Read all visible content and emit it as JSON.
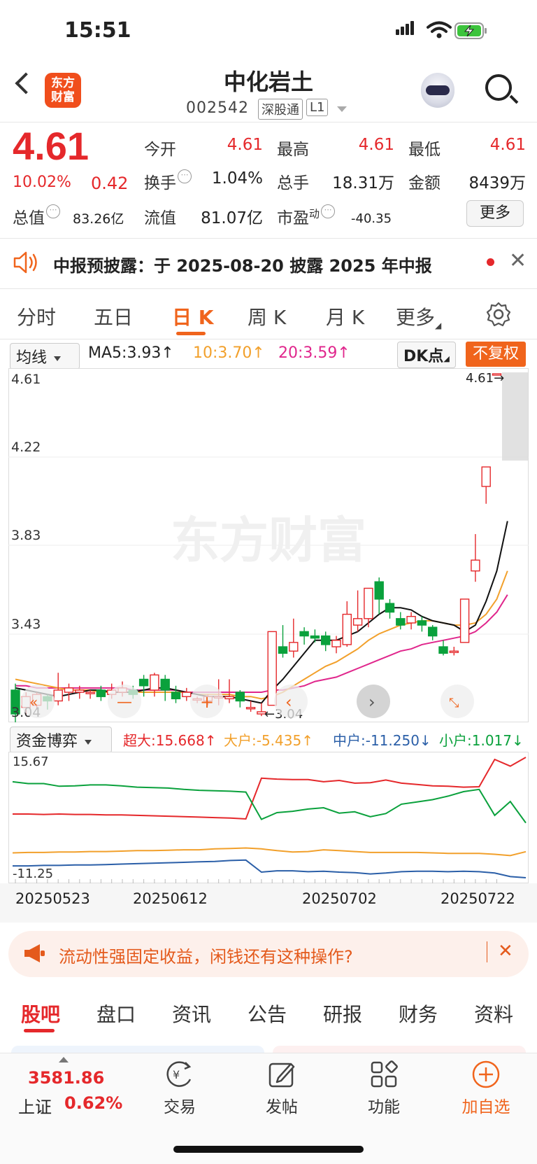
{
  "status_bar": {
    "time": "15:51"
  },
  "header": {
    "logo": "东方财富",
    "title": "中化岩土",
    "code": "002542",
    "tags": [
      "深股通",
      "L1"
    ]
  },
  "quote": {
    "price": "4.61",
    "change_pct": "10.02%",
    "change": "0.42",
    "fields": [
      {
        "label": "今开",
        "value": "4.61"
      },
      {
        "label": "最高",
        "value": "4.61"
      },
      {
        "label": "最低",
        "value": "4.61"
      },
      {
        "label": "换手",
        "value": "1.04%"
      },
      {
        "label": "总手",
        "value": "18.31万"
      },
      {
        "label": "金额",
        "value": "8439万"
      },
      {
        "label": "总值",
        "value": "83.26亿"
      },
      {
        "label": "流值",
        "value": "81.07亿"
      },
      {
        "label": "市盈",
        "sup": "动",
        "value": "-40.35"
      }
    ],
    "more_label": "更多"
  },
  "notice": {
    "text": "中报预披露：于 2025-08-20 披露 2025 年中报"
  },
  "chart_tabs": [
    "分时",
    "五日",
    "日 K",
    "周 K",
    "月 K",
    "更多"
  ],
  "chart_toolbar": {
    "indicator": "均线",
    "ma5": "MA5:3.93↑",
    "ma10": "10:3.70↑",
    "ma20": "20:3.59↑",
    "dk": "DK点",
    "fuquan": "不复权"
  },
  "kline": {
    "y_labels": [
      "4.61",
      "4.22",
      "3.83",
      "3.43",
      "3.04"
    ],
    "max_marker": "4.61→",
    "min_marker": "←3.04",
    "watermark": "东方财富"
  },
  "capital_toolbar": {
    "indicator": "资金博弈",
    "super": "超大:15.668↑",
    "large": "大户:-5.435↑",
    "mid": "中户:-11.250↓",
    "small": "小户:1.017↓"
  },
  "capital": {
    "y_top": "15.67",
    "y_bottom": "-11.25"
  },
  "x_dates": [
    "20250523",
    "20250612",
    "20250702",
    "20250722"
  ],
  "colors": {
    "up": "#e5282b",
    "down": "#0aa13c",
    "ma5": "#111111",
    "ma10": "#f2a02b",
    "ma20": "#e0268c",
    "mid": "#2b5fa8",
    "accent": "#f0641c"
  },
  "chart_data": {
    "type": "candlestick",
    "ylim": [
      3.04,
      4.61
    ],
    "candles": [
      [
        3.15,
        3.04,
        3.18,
        3.0
      ],
      [
        3.07,
        3.12,
        3.14,
        3.04
      ],
      [
        3.08,
        3.13,
        3.14,
        3.06
      ],
      [
        3.12,
        3.1,
        3.13,
        3.06
      ],
      [
        3.1,
        3.15,
        3.23,
        3.08
      ],
      [
        3.14,
        3.16,
        3.18,
        3.1
      ],
      [
        3.14,
        3.15,
        3.17,
        3.11
      ],
      [
        3.14,
        3.14,
        3.15,
        3.11
      ],
      [
        3.15,
        3.12,
        3.17,
        3.1
      ],
      [
        3.13,
        3.15,
        3.18,
        3.11
      ],
      [
        3.14,
        3.16,
        3.19,
        3.12
      ],
      [
        3.15,
        3.13,
        3.17,
        3.11
      ],
      [
        3.2,
        3.17,
        3.22,
        3.12
      ],
      [
        3.15,
        3.22,
        3.23,
        3.12
      ],
      [
        3.2,
        3.15,
        3.22,
        3.1
      ],
      [
        3.14,
        3.11,
        3.17,
        3.09
      ],
      [
        3.12,
        3.14,
        3.16,
        3.1
      ],
      [
        3.11,
        3.11,
        3.12,
        3.09
      ],
      [
        3.1,
        3.12,
        3.13,
        3.08
      ],
      [
        3.12,
        3.12,
        3.2,
        3.08
      ],
      [
        3.11,
        3.12,
        3.2,
        3.09
      ],
      [
        3.14,
        3.1,
        3.15,
        3.07
      ],
      [
        3.07,
        3.07,
        3.1,
        3.05
      ],
      [
        3.04,
        3.05,
        3.09,
        3.03
      ],
      [
        3.08,
        3.42,
        3.42,
        3.08
      ],
      [
        3.35,
        3.32,
        3.45,
        3.3
      ],
      [
        3.33,
        3.37,
        3.48,
        3.3
      ],
      [
        3.42,
        3.4,
        3.44,
        3.36
      ],
      [
        3.4,
        3.39,
        3.43,
        3.37
      ],
      [
        3.4,
        3.36,
        3.42,
        3.33
      ],
      [
        3.35,
        3.38,
        3.4,
        3.32
      ],
      [
        3.36,
        3.5,
        3.56,
        3.35
      ],
      [
        3.45,
        3.48,
        3.61,
        3.42
      ],
      [
        3.48,
        3.62,
        3.62,
        3.44
      ],
      [
        3.65,
        3.57,
        3.67,
        3.5
      ],
      [
        3.55,
        3.51,
        3.57,
        3.48
      ],
      [
        3.48,
        3.45,
        3.51,
        3.43
      ],
      [
        3.46,
        3.49,
        3.51,
        3.43
      ],
      [
        3.47,
        3.45,
        3.49,
        3.42
      ],
      [
        3.44,
        3.4,
        3.45,
        3.38
      ],
      [
        3.35,
        3.32,
        3.38,
        3.31
      ],
      [
        3.33,
        3.33,
        3.35,
        3.31
      ],
      [
        3.37,
        3.57,
        3.57,
        3.37
      ],
      [
        3.7,
        3.75,
        3.87,
        3.65
      ],
      [
        4.09,
        4.18,
        4.18,
        4.01
      ],
      [
        4.61,
        4.61,
        4.61,
        4.61
      ]
    ],
    "ma5": [
      3.16,
      3.15,
      3.14,
      3.13,
      3.12,
      3.13,
      3.14,
      3.15,
      3.15,
      3.14,
      3.14,
      3.14,
      3.15,
      3.16,
      3.16,
      3.15,
      3.14,
      3.13,
      3.12,
      3.12,
      3.12,
      3.11,
      3.1,
      3.09,
      3.15,
      3.2,
      3.26,
      3.32,
      3.38,
      3.38,
      3.38,
      3.4,
      3.42,
      3.46,
      3.5,
      3.53,
      3.53,
      3.52,
      3.49,
      3.47,
      3.46,
      3.45,
      3.42,
      3.45,
      3.56,
      3.7,
      3.93
    ],
    "ma10": [
      3.2,
      3.19,
      3.18,
      3.17,
      3.16,
      3.15,
      3.15,
      3.15,
      3.14,
      3.14,
      3.14,
      3.14,
      3.14,
      3.14,
      3.14,
      3.14,
      3.14,
      3.13,
      3.13,
      3.13,
      3.13,
      3.12,
      3.12,
      3.11,
      3.12,
      3.14,
      3.17,
      3.2,
      3.23,
      3.26,
      3.28,
      3.31,
      3.34,
      3.38,
      3.41,
      3.43,
      3.45,
      3.46,
      3.47,
      3.47,
      3.46,
      3.45,
      3.45,
      3.46,
      3.5,
      3.57,
      3.7
    ],
    "ma20": [
      3.17,
      3.17,
      3.16,
      3.16,
      3.16,
      3.16,
      3.16,
      3.16,
      3.16,
      3.16,
      3.16,
      3.15,
      3.15,
      3.15,
      3.15,
      3.15,
      3.14,
      3.14,
      3.14,
      3.14,
      3.14,
      3.14,
      3.14,
      3.14,
      3.15,
      3.15,
      3.16,
      3.17,
      3.19,
      3.2,
      3.21,
      3.23,
      3.25,
      3.27,
      3.29,
      3.31,
      3.33,
      3.34,
      3.36,
      3.37,
      3.38,
      3.39,
      3.4,
      3.42,
      3.46,
      3.51,
      3.59
    ],
    "capital_series": [
      {
        "name": "超大",
        "values": [
          3.0,
          3.0,
          2.9,
          3.0,
          2.9,
          2.9,
          2.8,
          2.8,
          2.7,
          2.6,
          2.5,
          2.4,
          2.3,
          2.2,
          2.1,
          1.9,
          11.0,
          10.8,
          10.7,
          10.7,
          10.2,
          10.5,
          9.9,
          10.0,
          10.6,
          9.9,
          9.6,
          9.3,
          9.2,
          9.0,
          9.1,
          15.2,
          13.7,
          15.67
        ]
      },
      {
        "name": "大户",
        "values": [
          -5.7,
          -5.6,
          -5.6,
          -5.5,
          -5.5,
          -5.4,
          -5.4,
          -5.3,
          -5.2,
          -5.2,
          -5.1,
          -5.0,
          -5.0,
          -4.8,
          -4.7,
          -4.6,
          -4.8,
          -5.2,
          -5.5,
          -5.4,
          -5.0,
          -5.2,
          -5.4,
          -5.6,
          -5.6,
          -5.6,
          -5.6,
          -5.7,
          -5.8,
          -5.8,
          -5.8,
          -6.0,
          -6.3,
          -5.435
        ]
      },
      {
        "name": "中户",
        "values": [
          -8.6,
          -8.6,
          -8.5,
          -8.5,
          -8.4,
          -8.4,
          -8.3,
          -8.2,
          -8.1,
          -8.0,
          -7.9,
          -7.8,
          -7.7,
          -7.6,
          -7.4,
          -7.3,
          -10.0,
          -9.7,
          -9.7,
          -9.9,
          -9.8,
          -10.0,
          -10.1,
          -10.4,
          -10.2,
          -9.9,
          -9.8,
          -9.8,
          -9.9,
          -9.8,
          -9.9,
          -10.2,
          -11.0,
          -11.25
        ]
      },
      {
        "name": "小户",
        "values": [
          10.2,
          9.8,
          9.8,
          9.2,
          9.3,
          9.5,
          9.5,
          9.3,
          9.0,
          8.9,
          8.8,
          8.5,
          8.3,
          8.2,
          8.1,
          7.9,
          1.8,
          3.3,
          3.6,
          4.1,
          4.4,
          3.2,
          3.5,
          2.4,
          3.1,
          5.2,
          5.7,
          6.2,
          7.0,
          8.0,
          8.5,
          2.7,
          5.8,
          1.017
        ]
      }
    ]
  },
  "ad": {
    "text": "流动性强固定收益，闲钱还有这种操作?"
  },
  "bottom_tabs": [
    "股吧",
    "盘口",
    "资讯",
    "公告",
    "研报",
    "财务",
    "资料"
  ],
  "bottom_nav": {
    "index_value": "3581.86",
    "index_name": "上证",
    "index_pct": "0.62%",
    "items": [
      "交易",
      "发帖",
      "功能",
      "加自选"
    ]
  }
}
